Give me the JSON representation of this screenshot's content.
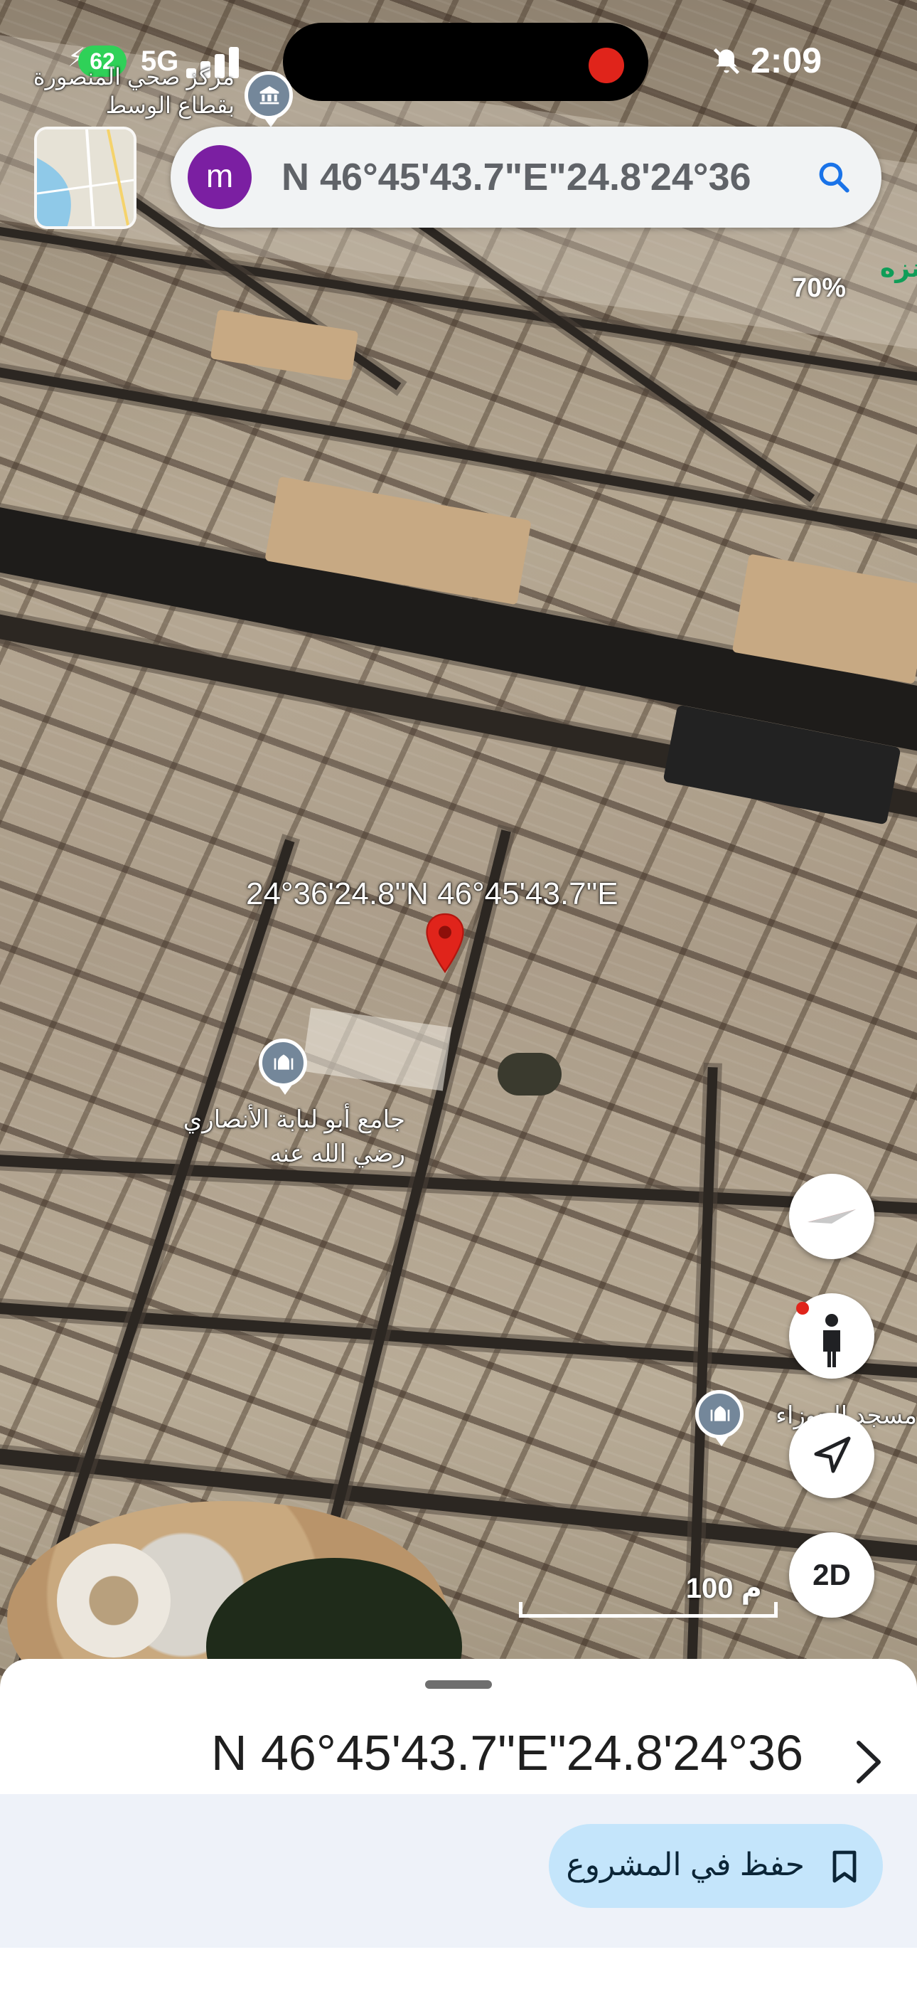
{
  "status_bar": {
    "battery": "62",
    "network": "5G",
    "time": "2:09"
  },
  "map_labels": {
    "health_center": "مركز صحي المنصورة بقطاع الوسط",
    "partial_top": "متنزه",
    "mosque_1": "جامع أبو لبابة الأنصاري رضي الله عنه",
    "mosque_2": "مسجد الجوزاء"
  },
  "search": {
    "avatar_letter": "m",
    "query": "N 46°45'43.7\"E\"24.8'24°36"
  },
  "map": {
    "zoom_percent": "70%",
    "dropped_pin_coords": "24°36'24.8\"N 46°45'43.7\"E",
    "scale_label": "100 م"
  },
  "controls": {
    "mode_toggle": "2D"
  },
  "sheet": {
    "title": "N 46°45'43.7\"E\"24.8'24°36",
    "save_label": "حفظ في المشروع"
  },
  "colors": {
    "pin": "#e0241b",
    "avatar": "#7b1fa2",
    "save_button_bg": "#c4e5fb",
    "battery_badge": "#2fd158"
  },
  "icons": [
    "search-icon",
    "compass-icon",
    "pegman-icon",
    "location-arrow-icon",
    "bookmark-icon",
    "chevron-right-icon",
    "mosque-icon",
    "landmark-icon",
    "bell-off-icon"
  ]
}
